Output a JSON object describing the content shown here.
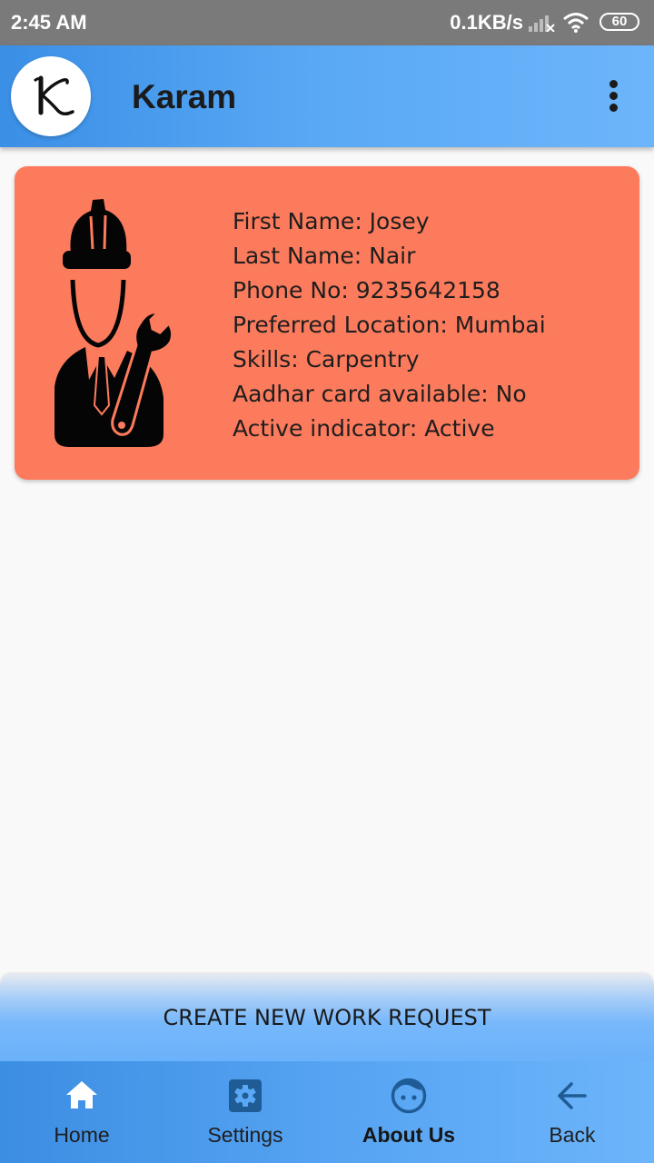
{
  "status_bar": {
    "time": "2:45 AM",
    "network_speed": "0.1KB/s",
    "battery": "60",
    "signal_icon": "signal-icon",
    "wifi_icon": "wifi-icon"
  },
  "app_bar": {
    "title": "Karam",
    "logo_letter": "K",
    "menu_icon": "more-vert-icon"
  },
  "profile_card": {
    "background_color": "#fd7b5d",
    "icon": "worker-icon",
    "lines": [
      "First Name: Josey",
      "Last Name: Nair",
      "Phone No: 9235642158",
      "Preferred Location: Mumbai",
      "Skills: Carpentry",
      "Aadhar card available: No",
      "Active indicator: Active"
    ]
  },
  "create_button": {
    "label": "CREATE NEW WORK REQUEST"
  },
  "bottom_nav": {
    "items": [
      {
        "label": "Home",
        "icon": "home-icon",
        "active": false
      },
      {
        "label": "Settings",
        "icon": "settings-icon",
        "active": false
      },
      {
        "label": "About Us",
        "icon": "face-icon",
        "active": true
      },
      {
        "label": "Back",
        "icon": "arrow-back-icon",
        "active": false
      }
    ]
  },
  "colors": {
    "app_bar": "#4a9cef",
    "card": "#fd7b5d",
    "status_bar": "#7a7a7a",
    "nav_icon": "#ffffff",
    "nav_icon_secondary": "#1f5c95"
  }
}
